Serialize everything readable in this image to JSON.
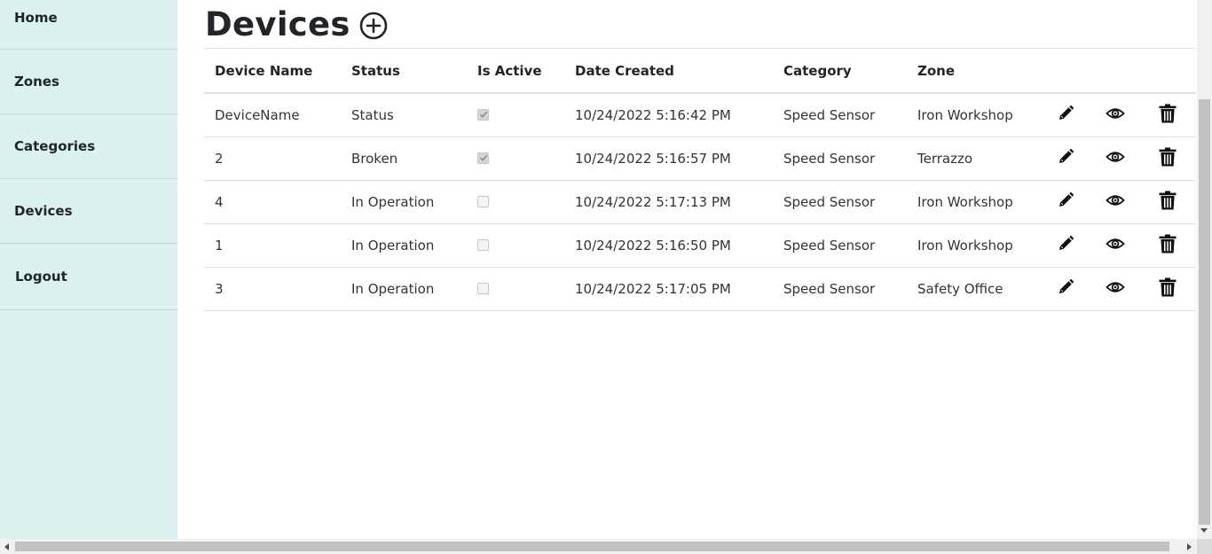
{
  "sidebar": {
    "items": [
      {
        "label": "Home"
      },
      {
        "label": "Zones"
      },
      {
        "label": "Categories"
      },
      {
        "label": "Devices"
      },
      {
        "label": "Logout"
      }
    ]
  },
  "page": {
    "title": "Devices",
    "add_icon": "plus-circle-icon"
  },
  "table": {
    "headers": [
      "Device Name",
      "Status",
      "Is Active",
      "Date Created",
      "Category",
      "Zone"
    ],
    "rows": [
      {
        "name": "DeviceName",
        "status": "Status",
        "active": true,
        "date": "10/24/2022 5:16:42 PM",
        "category": "Speed Sensor",
        "zone": "Iron Workshop"
      },
      {
        "name": "2",
        "status": "Broken",
        "active": true,
        "date": "10/24/2022 5:16:57 PM",
        "category": "Speed Sensor",
        "zone": "Terrazzo"
      },
      {
        "name": "4",
        "status": "In Operation",
        "active": false,
        "date": "10/24/2022 5:17:13 PM",
        "category": "Speed Sensor",
        "zone": "Iron Workshop"
      },
      {
        "name": "1",
        "status": "In Operation",
        "active": false,
        "date": "10/24/2022 5:16:50 PM",
        "category": "Speed Sensor",
        "zone": "Iron Workshop"
      },
      {
        "name": "3",
        "status": "In Operation",
        "active": false,
        "date": "10/24/2022 5:17:05 PM",
        "category": "Speed Sensor",
        "zone": "Safety Office"
      }
    ],
    "row_action_icons": [
      "pencil-icon",
      "eye-icon",
      "trash-icon"
    ]
  },
  "colors": {
    "sidebar_bg": "#dcf2f0",
    "text": "#212529",
    "border": "#dee2e6"
  }
}
